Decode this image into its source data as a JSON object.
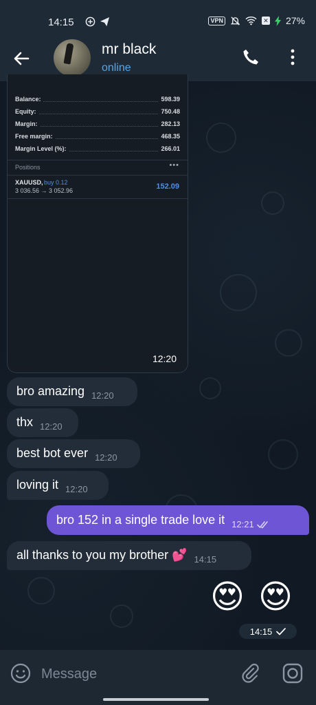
{
  "status_bar": {
    "time": "14:15",
    "vpn_label": "VPN",
    "battery_percent": "27%",
    "icons": [
      "circle-plus-icon",
      "send-plane-icon",
      "vpn-badge",
      "mute-bell-icon",
      "wifi-icon",
      "battery-saver-icon",
      "charging-icon"
    ]
  },
  "header": {
    "name": "mr black",
    "status": "online",
    "accent_color": "#5aa6e4"
  },
  "screenshot_message": {
    "account": [
      {
        "label": "Balance:",
        "value": "598.39"
      },
      {
        "label": "Equity:",
        "value": "750.48"
      },
      {
        "label": "Margin:",
        "value": "282.13"
      },
      {
        "label": "Free margin:",
        "value": "468.35"
      },
      {
        "label": "Margin Level (%):",
        "value": "266.01"
      }
    ],
    "positions_title": "Positions",
    "positions_more": "•••",
    "position": {
      "symbol": "XAUUSD,",
      "side": "buy 0.12",
      "prices": "3 036.56 → 3 052.96",
      "profit": "152.09"
    },
    "time": "12:20"
  },
  "messages": [
    {
      "text": "bro amazing",
      "time": "12:20"
    },
    {
      "text": "thx",
      "time": "12:20"
    },
    {
      "text": "best bot ever",
      "time": "12:20"
    },
    {
      "text": "loving it",
      "time": "12:20"
    }
  ],
  "outgoing": {
    "text": "bro 152 in a single trade love it",
    "time": "12:21",
    "status": "read",
    "bubble_color": "#6e55d6"
  },
  "incoming_last": {
    "text": "all thanks to you my brother 💕",
    "time": "14:15"
  },
  "emoji_message": {
    "emojis": [
      "😍",
      "😍"
    ],
    "time": "14:15",
    "status": "sent"
  },
  "composer": {
    "placeholder": "Message"
  }
}
